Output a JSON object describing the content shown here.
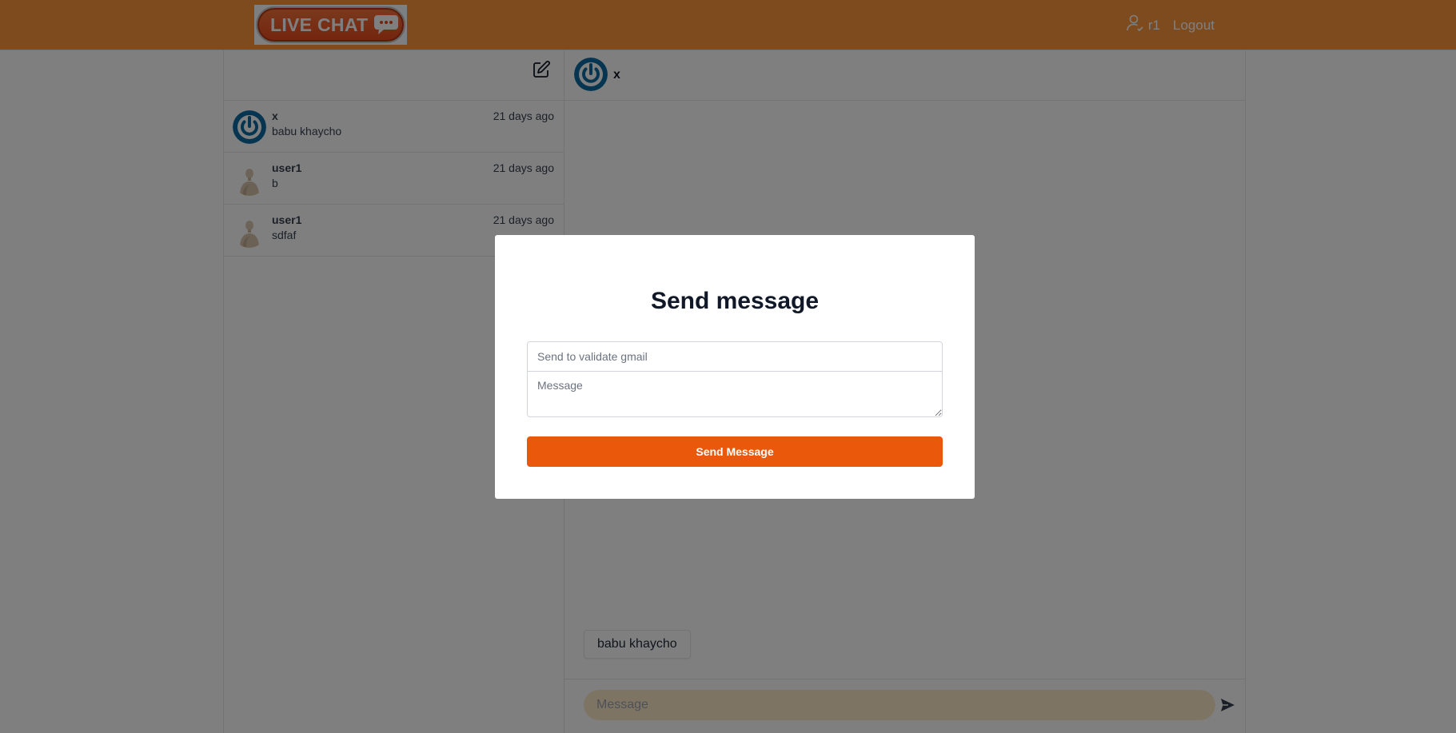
{
  "header": {
    "logo_text": "LIVE CHAT",
    "username": "r1",
    "logout_label": "Logout",
    "bg_color": "#fd973f"
  },
  "sidebar": {
    "conversations": [
      {
        "name": "x",
        "last_message": "babu khaycho",
        "time": "21 days ago",
        "avatar": "power-icon-avatar"
      },
      {
        "name": "user1",
        "last_message": "b",
        "time": "21 days ago",
        "avatar": "mannequin-avatar"
      },
      {
        "name": "user1",
        "last_message": "sdfaf",
        "time": "21 days ago",
        "avatar": "mannequin-avatar"
      }
    ]
  },
  "chat": {
    "title": "x",
    "messages": [
      {
        "text": "babu khaycho"
      }
    ],
    "input_placeholder": "Message"
  },
  "modal": {
    "title": "Send message",
    "email_placeholder": "Send to validate gmail",
    "message_placeholder": "Message",
    "send_label": "Send Message",
    "accent_color": "#ea580c"
  }
}
